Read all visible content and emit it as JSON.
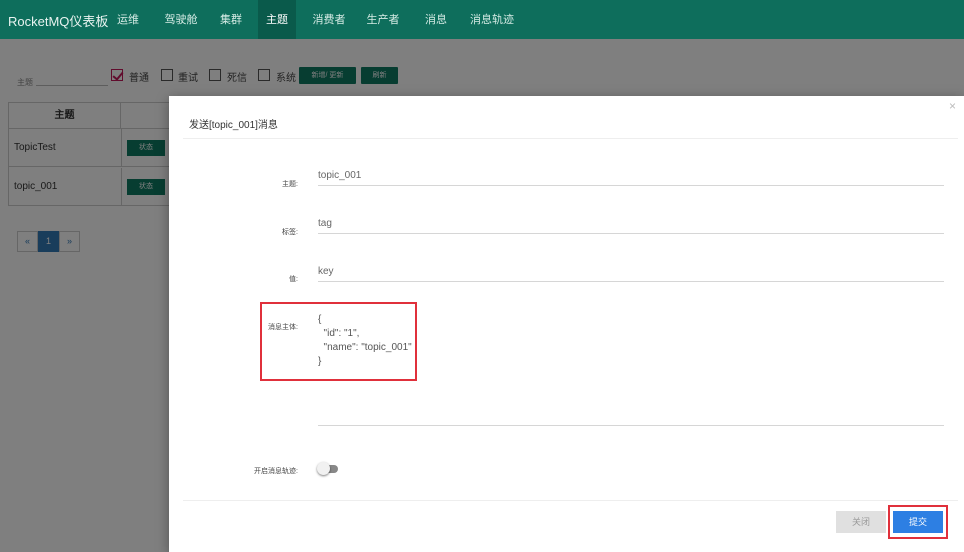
{
  "navbar": {
    "brand": "RocketMQ仪表板",
    "items": [
      {
        "label": "运维"
      },
      {
        "label": "驾驶舱"
      },
      {
        "label": "集群"
      },
      {
        "label": "主题"
      },
      {
        "label": "消费者"
      },
      {
        "label": "生产者"
      },
      {
        "label": "消息"
      },
      {
        "label": "消息轨迹"
      }
    ],
    "active_index": 3
  },
  "filters": {
    "topic_label": "主题",
    "topic_value": "",
    "checkboxes": [
      {
        "label": "普通",
        "checked": true
      },
      {
        "label": "重试",
        "checked": false
      },
      {
        "label": "死信",
        "checked": false
      },
      {
        "label": "系统",
        "checked": false
      }
    ],
    "add_update_button": "新增/ 更新",
    "refresh_button": "刷新"
  },
  "topic_table": {
    "header": "主题",
    "rows": [
      {
        "name": "TopicTest",
        "status_button": "状态"
      },
      {
        "name": "topic_001",
        "status_button": "状态"
      }
    ]
  },
  "pagination": {
    "prev": "«",
    "current": "1",
    "next": "»"
  },
  "modal": {
    "title": "发送[topic_001]消息",
    "close_icon": "×",
    "fields": {
      "topic_label": "主题:",
      "topic_value": "topic_001",
      "tag_label": "标签:",
      "tag_value": "tag",
      "key_label": "值:",
      "key_value": "key",
      "body_label": "消息主体:",
      "body_value": "{\n  \"id\": \"1\",\n  \"name\": \"topic_001\"\n}",
      "trace_label": "开启消息轨迹:",
      "trace_enabled": false
    },
    "close_button": "关闭",
    "submit_button": "提交"
  },
  "colors": {
    "navbar": "#0e6e5c",
    "primary_green": "#0e7a63",
    "submit_blue": "#2d7fe3",
    "highlight_red": "#e0303b",
    "checkbox_pink": "#c2185b"
  }
}
